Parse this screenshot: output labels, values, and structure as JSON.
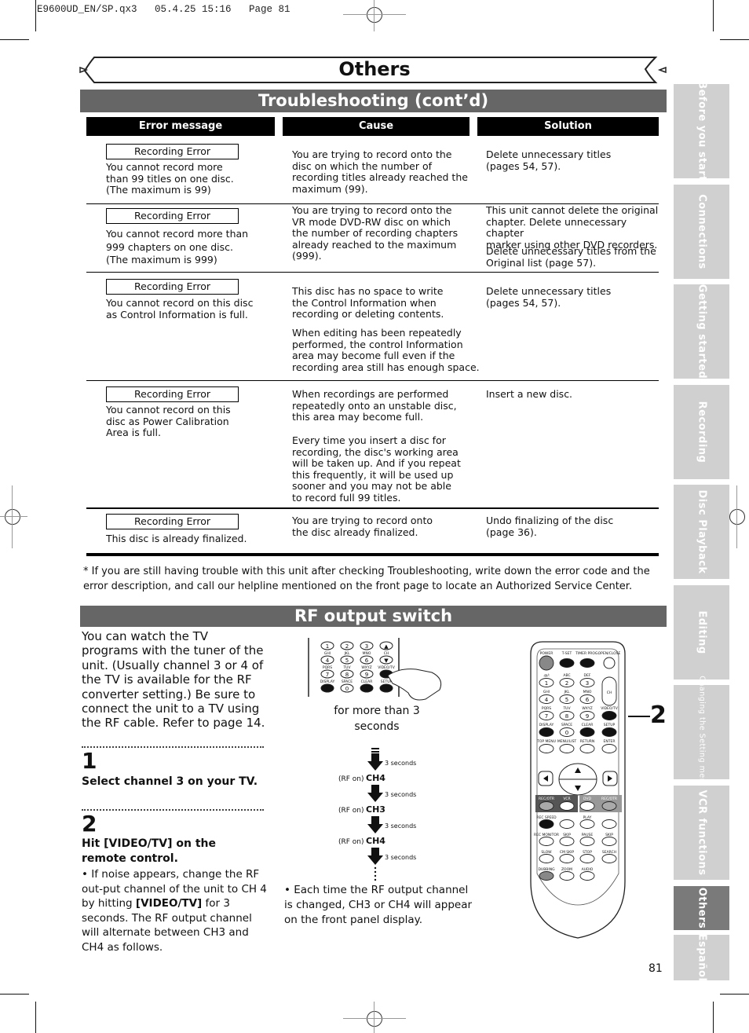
{
  "slug": "E9600UD_EN/SP.qx3   05.4.25 15:16   Page 81",
  "chapter_title": "Others",
  "section1": {
    "title": "Troubleshooting (cont’d)",
    "headers": [
      "Error message",
      "Cause",
      "Solution"
    ],
    "rows": [
      {
        "error_label": "Recording Error",
        "error_text": "You cannot record more\nthan 99 titles on one disc.\n(The maximum is 99)",
        "cause": "You are trying to record onto the\ndisc on which the number of\nrecording titles already reached the\nmaximum (99).",
        "solution": "Delete unnecessary titles\n(pages 54, 57)."
      },
      {
        "error_label": "Recording Error",
        "error_text": "You cannot record more than\n999 chapters on one disc.\n(The maximum is 999)",
        "cause": "You are trying to record onto the\nVR mode DVD-RW disc on which\nthe number of recording chapters\nalready reached to the maximum\n(999).",
        "solution": "This unit cannot delete the original\nchapter. Delete unnecessary chapter\nmarker using other DVD recorders.",
        "solution2": "Delete unnecessary titles from the\nOriginal list (page 57)."
      },
      {
        "error_label": "Recording Error",
        "error_text": "You cannot record on this disc\nas Control Information is full.",
        "cause": "This disc has no space to write\nthe Control Information when\nrecording or deleting contents.",
        "cause2": "When editing has been repeatedly\nperformed, the control Information\narea may become full even if the\nrecording area still has enough space.",
        "solution": "Delete unnecessary titles\n(pages 54, 57)."
      },
      {
        "error_label": "Recording Error",
        "error_text": "You cannot record on this\ndisc as Power Calibration\nArea is full.",
        "cause": "When recordings are performed\nrepeatedly onto an unstable disc,\nthis area may become full.",
        "cause2": "Every time you insert a disc for\nrecording, the disc's working area\nwill be taken up.  And if you repeat\nthis frequently, it will be used up\nsooner and you may not be able\nto record full 99 titles.",
        "solution": "Insert a new disc."
      },
      {
        "error_label": "Recording Error",
        "error_text": "This disc is already finalized.",
        "cause": "You are trying to record onto\nthe disc already finalized.",
        "solution": "Undo finalizing of the disc\n(page 36)."
      }
    ],
    "footnote": "* If you are still having trouble with this unit after checking Troubleshooting, write down the error code and the error description, and call our helpline mentioned on the front page to locate an Authorized Service Center."
  },
  "section2": {
    "title": "RF output switch",
    "intro": "You can watch the TV programs with the tuner of the unit. (Usually channel 3 or 4 of the TV is available for the RF converter setting.) Be sure to connect the unit to a TV using the RF cable. Refer to page 14.",
    "step1": {
      "number": "1",
      "title": "Select channel 3 on your TV."
    },
    "step2": {
      "number": "2",
      "title": "Hit [VIDEO/TV] on the remote control.",
      "bullet_pre": "• If noise appears, change the RF out-put channel of the unit to CH 4 by hitting ",
      "bullet_bold": "[VIDEO/TV]",
      "bullet_post": " for 3 seconds. The RF output channel will alternate between CH3 and CH4 as follows."
    },
    "hold_caption": "for more than 3 seconds",
    "flow": {
      "interval": "3 seconds",
      "prefix": "(RF on)",
      "states": [
        "CH4",
        "CH3",
        "CH4"
      ]
    },
    "each_note": "• Each time the RF output channel is changed, CH3 or CH4 will appear on the front panel display.",
    "callout": "2",
    "keypad_small": {
      "keys": [
        "1",
        "2",
        "3",
        "▲",
        "4",
        "5",
        "6",
        "▼",
        "7",
        "8",
        "9",
        "",
        "",
        "0",
        "",
        ""
      ],
      "labels": [
        "GHI",
        "JKL",
        "MNO",
        "CH",
        "PQRS",
        "TUV",
        "WXYZ",
        "VIDEO/TV",
        "DISPLAY",
        "SPACE",
        "CLEAR",
        "SETUP"
      ]
    },
    "remote": {
      "top_labels": [
        "POWER",
        "T-SET",
        "TIMER PROG.",
        "OPEN/CLOSE"
      ],
      "row_labels": [
        ".@/:",
        "ABC",
        "DEF",
        "GHI",
        "JKL",
        "MNO",
        "PQRS",
        "TUV",
        "WXYZ",
        "VIDEO/TV",
        "DISPLAY",
        "SPACE",
        "CLEAR",
        "SETUP",
        "TOP MENU",
        "MENU/LIST",
        "RETURN",
        "ENTER"
      ],
      "digits": [
        "1",
        "2",
        "3",
        "4",
        "5",
        "6",
        "7",
        "8",
        "9",
        "0"
      ],
      "ch_label": "CH",
      "mode_labels": [
        "REC/OTR",
        "VCR",
        "DVD",
        "REC/OTR"
      ],
      "transport_labels": [
        "REC SPEED",
        "PLAY",
        "REC MONITOR",
        "SKIP",
        "PAUSE",
        "SKIP",
        "SLOW",
        "CM SKIP",
        "STOP",
        "SEARCH",
        "DUBBING",
        "ZOOM",
        "AUDIO"
      ]
    }
  },
  "side_tabs": [
    {
      "label": "Before you start",
      "active": false
    },
    {
      "label": "Connections",
      "active": false
    },
    {
      "label": "Getting started",
      "active": false
    },
    {
      "label": "Recording",
      "active": false
    },
    {
      "label": "Disc Playback",
      "active": false
    },
    {
      "label": "Editing",
      "active": false
    },
    {
      "label": "Changing the Setting menu",
      "active": false
    },
    {
      "label": "VCR functions",
      "active": false
    },
    {
      "label": "Others",
      "active": true
    },
    {
      "label": "Español",
      "active": false
    }
  ],
  "page_number": "81"
}
